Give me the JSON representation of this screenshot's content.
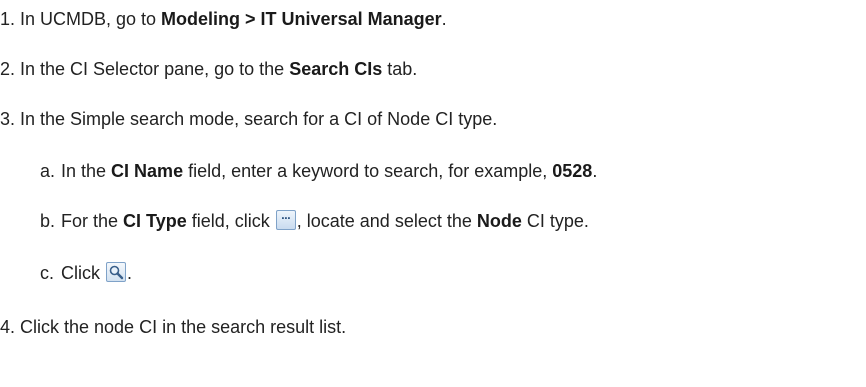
{
  "steps": [
    {
      "num": "1.",
      "before": "In UCMDB, go to ",
      "bold": "Modeling > IT Universal Manager",
      "after": "."
    },
    {
      "num": "2.",
      "before": "In the CI Selector pane, go to the ",
      "bold": "Search CIs",
      "after": " tab."
    },
    {
      "num": "3.",
      "text": "In the Simple search mode, search for a CI of Node CI type."
    },
    {
      "num": "4.",
      "text": "Click the node CI in the search result list."
    }
  ],
  "substeps": [
    {
      "num": "a.",
      "before": "In the ",
      "bold": "CI Name",
      "middle": " field, enter a keyword to search, for example, ",
      "bold2": "0528",
      "after": "."
    },
    {
      "num": "b.",
      "before": "For the ",
      "bold": "CI Type",
      "middle": " field, click ",
      "middle2": ", locate and select the ",
      "bold2": "Node",
      "after": " CI type."
    },
    {
      "num": "c.",
      "before": "Click ",
      "after": "."
    }
  ],
  "icons": {
    "ellipsis": "ellipsis-button-icon",
    "search": "magnifier-search-icon",
    "ellipsis_glyph": "···"
  }
}
